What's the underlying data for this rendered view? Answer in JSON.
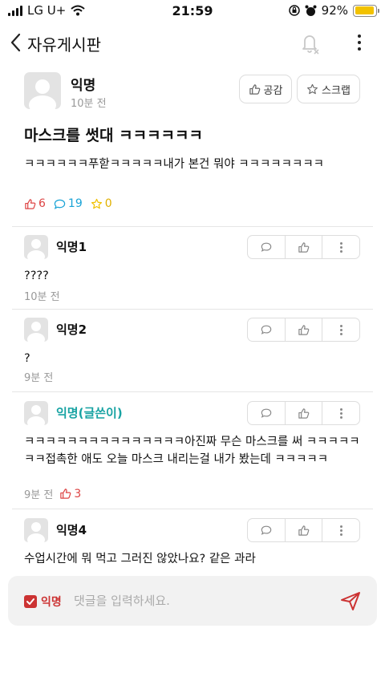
{
  "status": {
    "carrier": "LG U+",
    "time": "21:59",
    "battery": "92%",
    "battery_level": 0.92
  },
  "header": {
    "title": "자유게시판"
  },
  "post": {
    "author": "익명",
    "time": "10분 전",
    "empathy_label": "공감",
    "scrap_label": "스크랩",
    "title": "마스크를 썻대 ㅋㅋㅋㅋㅋㅋ",
    "body": "ㅋㅋㅋㅋㅋㅋ푸핟ㅋㅋㅋㅋㅋ내가 본건 뭐야 ㅋㅋㅋㅋㅋㅋㅋㅋ",
    "likes": "6",
    "comments": "19",
    "scraps": "0"
  },
  "comments": [
    {
      "name": "익명1",
      "text": "????",
      "time": "10분 전"
    },
    {
      "name": "익명2",
      "text": "?",
      "time": "9분 전"
    },
    {
      "name": "익명(글쓴이)",
      "text": "ㅋㅋㅋㅋㅋㅋㅋㅋㅋㅋㅋㅋㅋㅋㅋ아진짜 무슨 마스크를 써 ㅋㅋㅋㅋㅋㅋㅋ접촉한 애도 오늘 마스크 내리는걸 내가 봤는데 ㅋㅋㅋㅋㅋ",
      "time": "9분 전",
      "likes": "3"
    },
    {
      "name": "익명4",
      "text": "수업시간에 뭐 먹고 그러진 않았나요? 같은 과라"
    }
  ],
  "input": {
    "anon_label": "익명",
    "placeholder": "댓글을 입력하세요."
  },
  "colors": {
    "like": "#d44",
    "comment": "#19a3d6",
    "scrap": "#f0c000",
    "op_name": "#18a3a3",
    "anon": "#cc3333"
  }
}
